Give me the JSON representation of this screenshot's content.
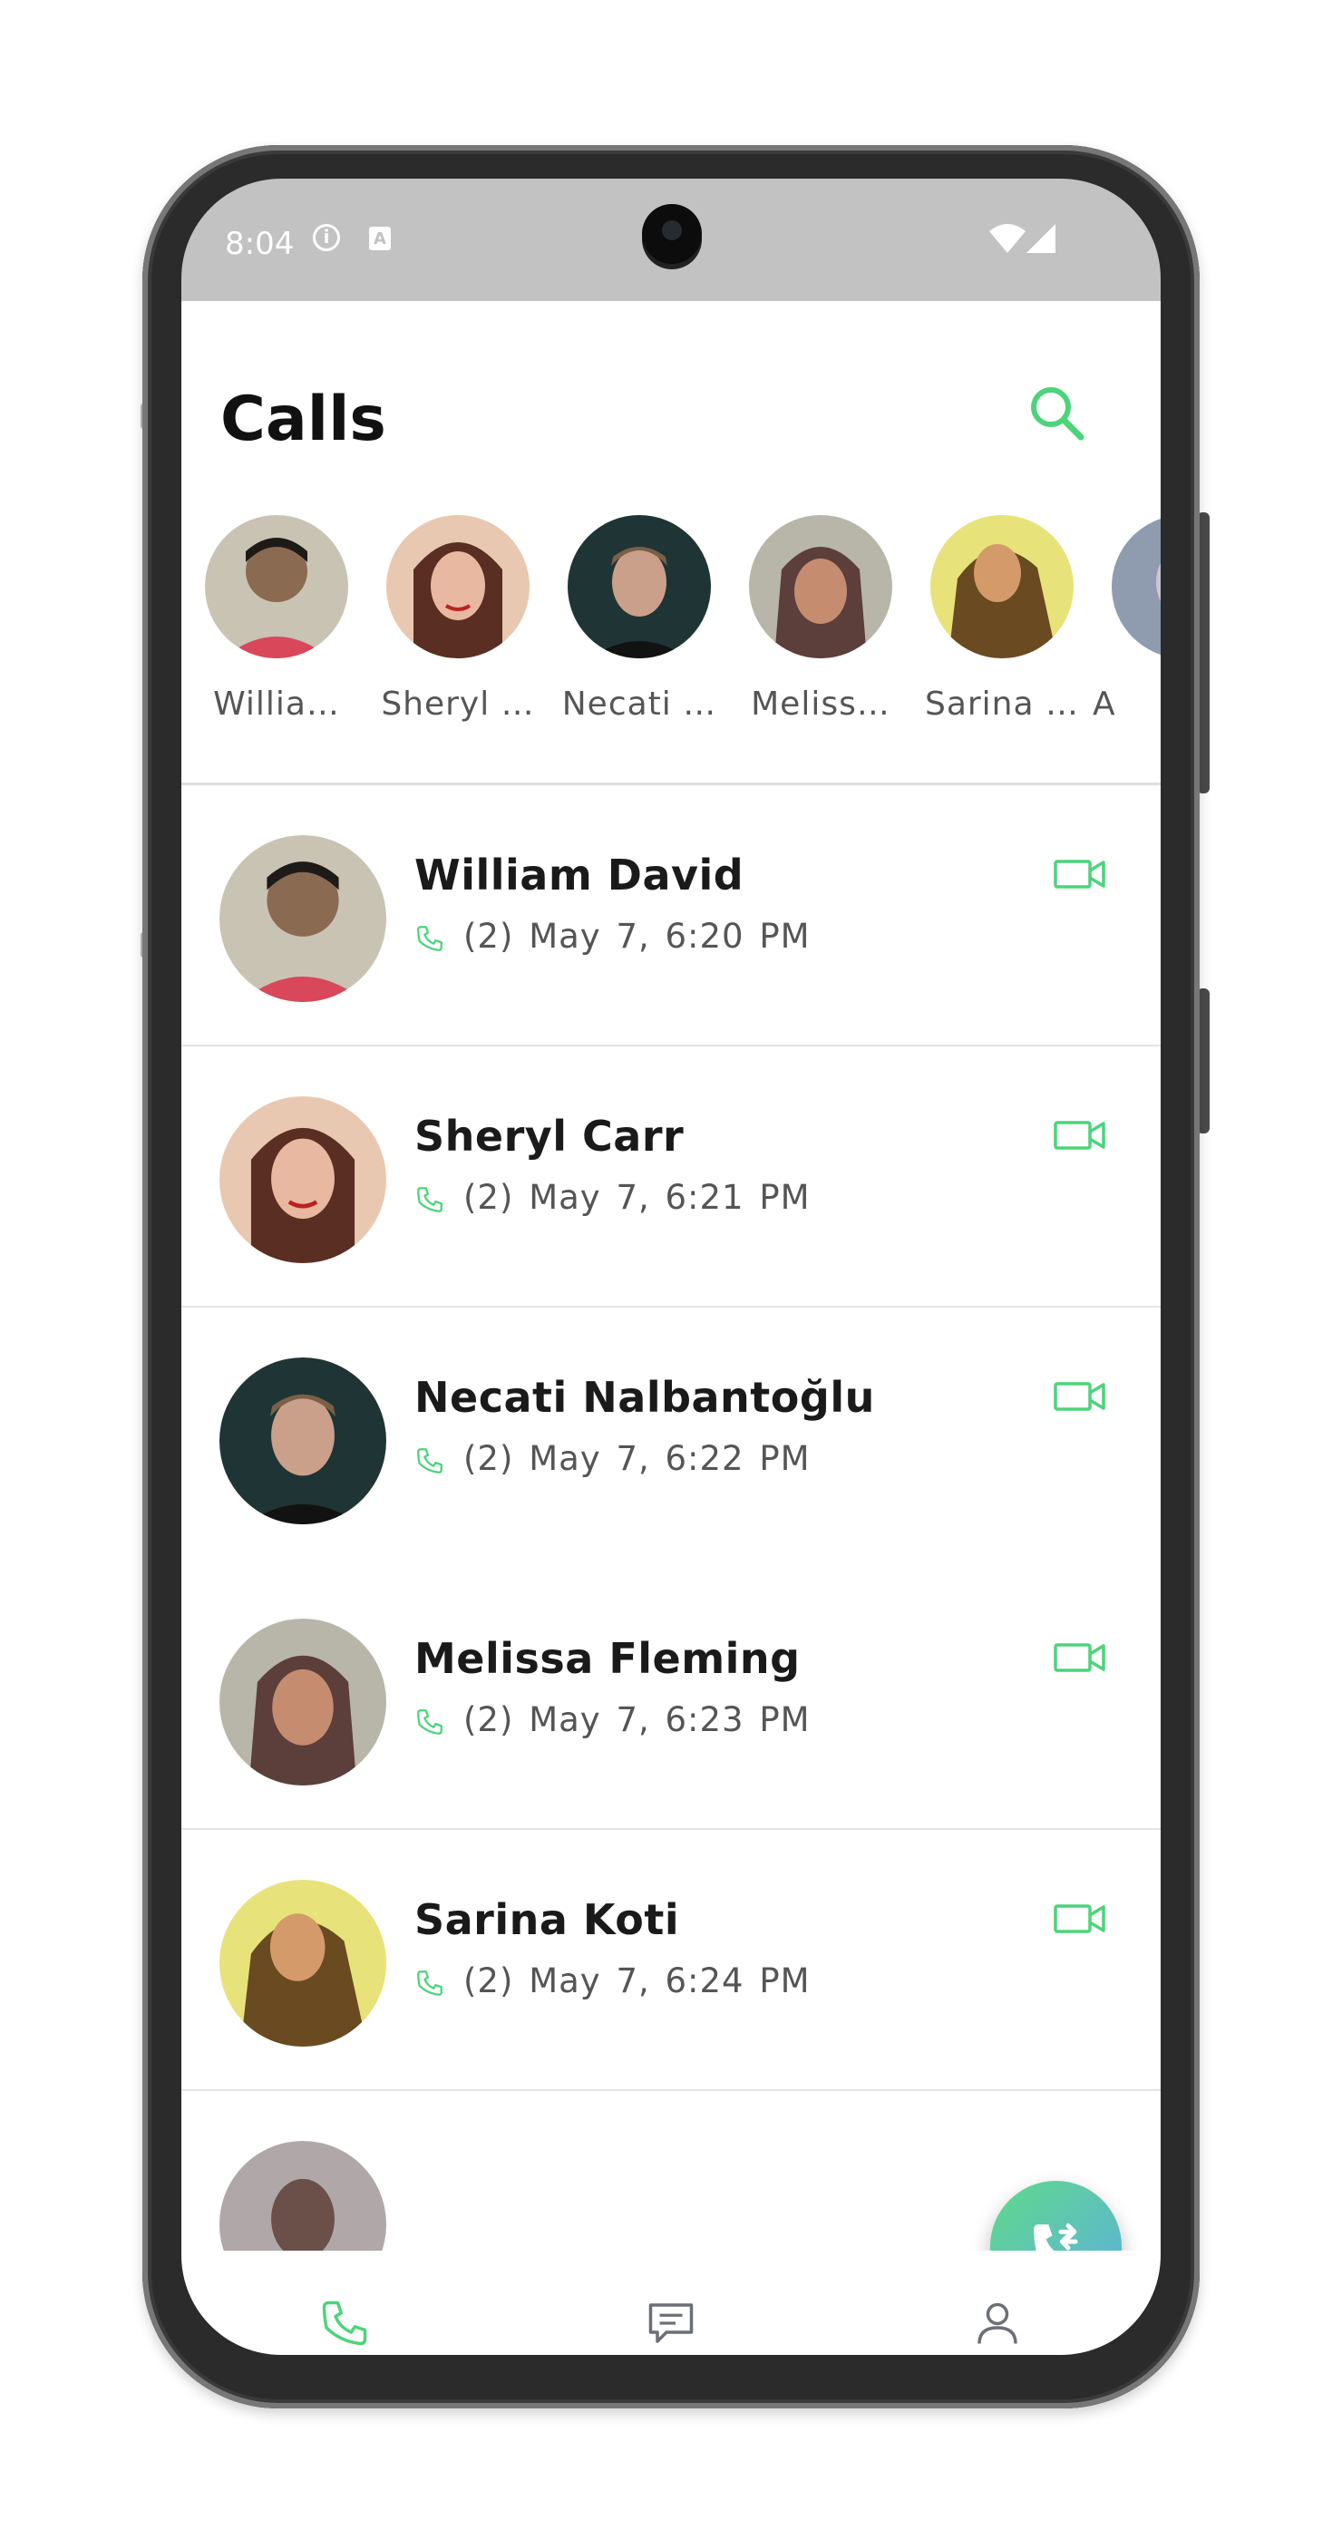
{
  "status_bar": {
    "time": "8:04",
    "info_icon": "info-icon",
    "a_icon": "A",
    "wifi_icon": "wifi-icon",
    "signal_icon": "signal-icon"
  },
  "header": {
    "title": "Calls",
    "search_icon": "search-icon"
  },
  "stories": [
    {
      "label": "Willia…",
      "avatar_color": "#9a8a70"
    },
    {
      "label": "Sheryl …",
      "avatar_color": "#b98a78"
    },
    {
      "label": "Necati …",
      "avatar_color": "#2c3a3a"
    },
    {
      "label": "Meliss…",
      "avatar_color": "#8c6c62"
    },
    {
      "label": "Sarina …",
      "avatar_color": "#a89a40"
    },
    {
      "label": "A",
      "avatar_color": "#8090a8"
    }
  ],
  "calls": [
    {
      "name": "William David",
      "count": "(2)",
      "time": "May 7, 6:20 PM",
      "avatar_color": "#9a8a70"
    },
    {
      "name": "Sheryl Carr",
      "count": "(2)",
      "time": "May 7, 6:21 PM",
      "avatar_color": "#b98a78"
    },
    {
      "name": "Necati Nalbantoğlu",
      "count": "(2)",
      "time": "May 7, 6:22 PM",
      "avatar_color": "#2c3a3a"
    },
    {
      "name": "Melissa Fleming",
      "count": "(2)",
      "time": "May 7, 6:23 PM",
      "avatar_color": "#8c6c62"
    },
    {
      "name": "Sarina Koti",
      "count": "(2)",
      "time": "May 7, 6:24 PM",
      "avatar_color": "#a89a40"
    }
  ],
  "fab": {
    "icon": "phone-forward-icon"
  },
  "bottom_nav": [
    {
      "icon": "phone-icon",
      "active": true
    },
    {
      "icon": "chat-icon",
      "active": false
    },
    {
      "icon": "user-icon",
      "active": false
    }
  ],
  "colors": {
    "accent": "#4cd47a",
    "text": "#1a1a1a",
    "muted": "#555555",
    "divider": "#e4e4e4",
    "statusbar": "#c2c2c2"
  }
}
